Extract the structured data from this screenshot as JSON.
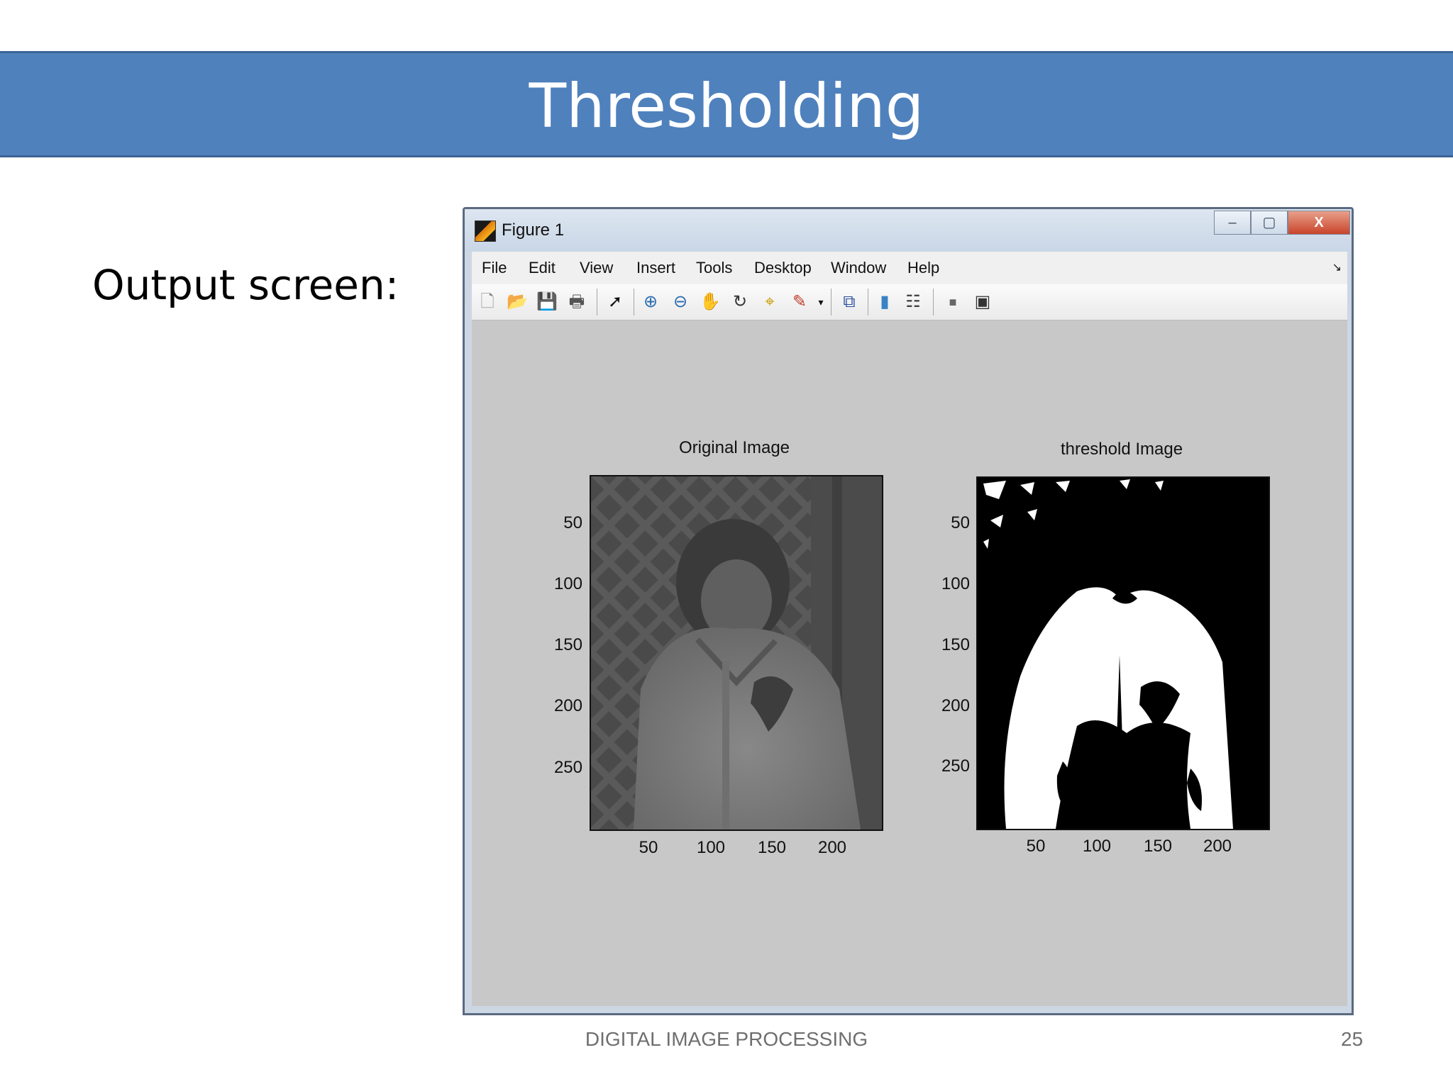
{
  "slide": {
    "title": "Thresholding",
    "side_label": "Output screen:",
    "footer": "DIGITAL IMAGE PROCESSING",
    "page_number": "25"
  },
  "window": {
    "title": "Figure 1",
    "controls": {
      "minimize": "–",
      "maximize": "▢",
      "close": "X"
    },
    "menu": [
      "File",
      "Edit",
      "View",
      "Insert",
      "Tools",
      "Desktop",
      "Window",
      "Help"
    ],
    "toolbar_icons": [
      "new-figure-icon",
      "open-file-icon",
      "save-icon",
      "print-icon",
      "edit-plot-arrow-icon",
      "zoom-in-icon",
      "zoom-out-icon",
      "pan-hand-icon",
      "rotate-3d-icon",
      "data-cursor-icon",
      "brush-icon",
      "link-plot-icon",
      "colorbar-icon",
      "legend-icon",
      "hide-plot-tools-icon",
      "show-plot-tools-icon"
    ]
  },
  "figure": {
    "axes": [
      {
        "title": "Original Image",
        "yticks": [
          "50",
          "100",
          "150",
          "200",
          "250"
        ],
        "xticks": [
          "50",
          "100",
          "150",
          "200"
        ]
      },
      {
        "title": "threshold Image",
        "yticks": [
          "50",
          "100",
          "150",
          "200",
          "250"
        ],
        "xticks": [
          "50",
          "100",
          "150",
          "200"
        ]
      }
    ]
  },
  "colors": {
    "banner": "#4f81bd",
    "canvas": "#c8c8c8",
    "threshold_black": "#000000",
    "threshold_white": "#ffffff"
  }
}
